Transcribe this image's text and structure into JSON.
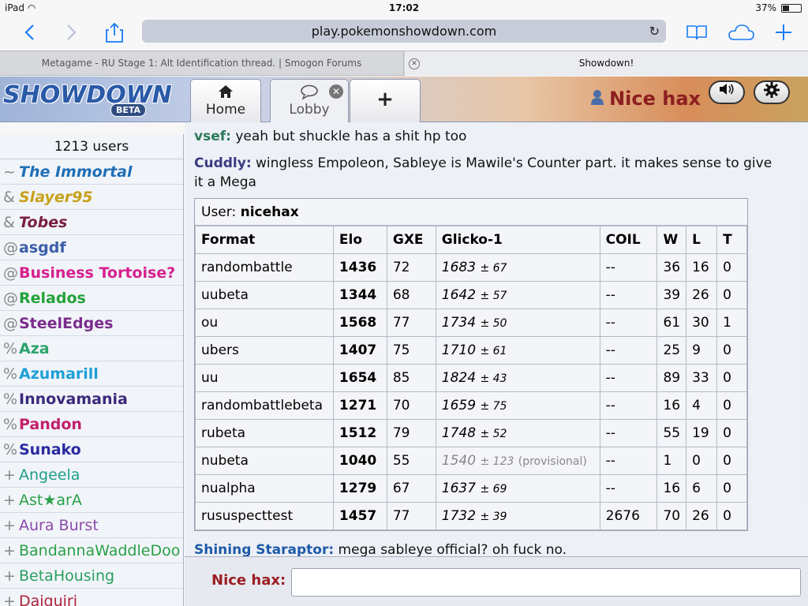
{
  "status": {
    "device": "iPad",
    "time": "17:02",
    "battery": "37%",
    "battery_level": 0.37
  },
  "browser": {
    "url": "play.pokemonshowdown.com",
    "tabs": [
      {
        "title": "Metagame - RU Stage 1: Alt Identification thread. | Smogon Forums"
      },
      {
        "title": "Showdown!"
      }
    ]
  },
  "app": {
    "logo": "SHOWDOWN",
    "beta": "BETA",
    "tabs": {
      "home": "Home",
      "lobby": "Lobby"
    },
    "username": "Nice hax"
  },
  "sidebar": {
    "user_count": "1213 users",
    "users": [
      {
        "sym": "~",
        "name": "The Immortal",
        "color": "#1f6fb6",
        "italic": true
      },
      {
        "sym": "&",
        "name": "Slayer95",
        "color": "#c7a21a",
        "italic": true
      },
      {
        "sym": "&",
        "name": "Tobes",
        "color": "#7a1f3f",
        "italic": true
      },
      {
        "sym": "@",
        "name": "asgdf",
        "color": "#3b5ea8",
        "italic": false
      },
      {
        "sym": "@",
        "name": "Business Tortoise?",
        "color": "#d6208e",
        "italic": false
      },
      {
        "sym": "@",
        "name": "Relados",
        "color": "#23a23a",
        "italic": false
      },
      {
        "sym": "@",
        "name": "SteelEdges",
        "color": "#7b2c8c",
        "italic": false
      },
      {
        "sym": "%",
        "name": "Aza",
        "color": "#2aa36b",
        "italic": false
      },
      {
        "sym": "%",
        "name": "Azumarill",
        "color": "#1e9fd6",
        "italic": false
      },
      {
        "sym": "%",
        "name": "Innovamania",
        "color": "#3b2a7a",
        "italic": false
      },
      {
        "sym": "%",
        "name": "Pandon",
        "color": "#c3206a",
        "italic": false
      },
      {
        "sym": "%",
        "name": "Sunako",
        "color": "#2a2aa0",
        "italic": false
      },
      {
        "sym": "+",
        "name": "Angeela",
        "color": "#1f9e8a",
        "italic": false,
        "plain": true
      },
      {
        "sym": "+",
        "name": "Ast★arA",
        "color": "#2aa048",
        "italic": false,
        "plain": true
      },
      {
        "sym": "+",
        "name": "Aura Burst",
        "color": "#8a4aaa",
        "italic": false,
        "plain": true
      },
      {
        "sym": "+",
        "name": "BandannaWaddleDoo",
        "color": "#2aa048",
        "italic": false,
        "plain": true
      },
      {
        "sym": "+",
        "name": "BetaHousing",
        "color": "#2aa060",
        "italic": false,
        "plain": true
      },
      {
        "sym": "+",
        "name": "Daiquiri",
        "color": "#b0203a",
        "italic": false,
        "plain": true
      }
    ]
  },
  "chat": {
    "messages": [
      {
        "user": "vsef:",
        "text": " yeah but shuckle has a shit hp too",
        "color": "#2a7a5a"
      },
      {
        "user": "Cuddly:",
        "text": " wingless Empoleon, Sableye is Mawile's Counter part. it makes sense to give it a Mega",
        "color": "#3a3a80"
      },
      {
        "user": "Shining Staraptor:",
        "text": " mega sableye official? oh fuck no.",
        "color": "#1e5aa8"
      }
    ],
    "stats": {
      "user_label": "User: ",
      "user": "nicehax",
      "headers": [
        "Format",
        "Elo",
        "GXE",
        "Glicko-1",
        "COIL",
        "W",
        "L",
        "T"
      ],
      "rows": [
        {
          "format": "randombattle",
          "elo": "1436",
          "gxe": "72",
          "glicko": "1683",
          "dev": "± 67",
          "coil": "--",
          "w": "36",
          "l": "16",
          "t": "0"
        },
        {
          "format": "uubeta",
          "elo": "1344",
          "gxe": "68",
          "glicko": "1642",
          "dev": "± 57",
          "coil": "--",
          "w": "39",
          "l": "26",
          "t": "0"
        },
        {
          "format": "ou",
          "elo": "1568",
          "gxe": "77",
          "glicko": "1734",
          "dev": "± 50",
          "coil": "--",
          "w": "61",
          "l": "30",
          "t": "1"
        },
        {
          "format": "ubers",
          "elo": "1407",
          "gxe": "75",
          "glicko": "1710",
          "dev": "± 61",
          "coil": "--",
          "w": "25",
          "l": "9",
          "t": "0"
        },
        {
          "format": "uu",
          "elo": "1654",
          "gxe": "85",
          "glicko": "1824",
          "dev": "± 43",
          "coil": "--",
          "w": "89",
          "l": "33",
          "t": "0"
        },
        {
          "format": "randombattlebeta",
          "elo": "1271",
          "gxe": "70",
          "glicko": "1659",
          "dev": "± 75",
          "coil": "--",
          "w": "16",
          "l": "4",
          "t": "0"
        },
        {
          "format": "rubeta",
          "elo": "1512",
          "gxe": "79",
          "glicko": "1748",
          "dev": "± 52",
          "coil": "--",
          "w": "55",
          "l": "19",
          "t": "0"
        },
        {
          "format": "nubeta",
          "elo": "1040",
          "gxe": "55",
          "glicko": "1540",
          "dev": "± 123",
          "note": "(provisional)",
          "coil": "--",
          "w": "1",
          "l": "0",
          "t": "0"
        },
        {
          "format": "nualpha",
          "elo": "1279",
          "gxe": "67",
          "glicko": "1637",
          "dev": "± 69",
          "coil": "--",
          "w": "16",
          "l": "6",
          "t": "0"
        },
        {
          "format": "rususpecttest",
          "elo": "1457",
          "gxe": "77",
          "glicko": "1732",
          "dev": "± 39",
          "coil": "2676",
          "w": "70",
          "l": "26",
          "t": "0"
        }
      ]
    }
  },
  "input": {
    "label": "Nice hax:",
    "value": ""
  }
}
